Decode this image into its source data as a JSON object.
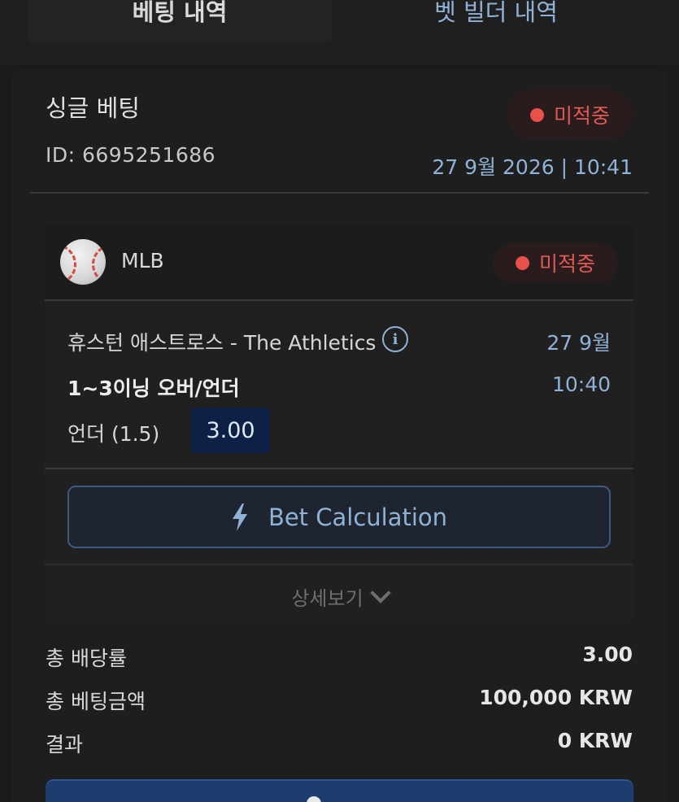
{
  "tabs": {
    "betting_history": "베팅 내역",
    "bet_builder_history": "벳 빌더 내역"
  },
  "bet": {
    "type": "싱글 베팅",
    "id": "ID: 6695251686",
    "status": "미적중",
    "datetime": "27 9월 2026 | 10:41"
  },
  "selection": {
    "league": "MLB",
    "status": "미적중",
    "match": "휴스턴 애스트로스 - The Athletics",
    "match_date": "27 9월",
    "market": "1~3이닝 오버/언더",
    "match_time": "10:40",
    "pick": "언더 (1.5)",
    "odds": "3.00"
  },
  "actions": {
    "bet_calculation": "Bet Calculation",
    "details": "상세보기"
  },
  "summary": {
    "total_odds_label": "총 배당률",
    "total_odds_value": "3.00",
    "total_stake_label": "총 베팅금액",
    "total_stake_value": "100,000 KRW",
    "result_label": "결과",
    "result_value": "0 KRW"
  },
  "colors": {
    "accent_blue": "#8fb2d6",
    "lost_red": "#e05a55",
    "odds_box": "#0f2046",
    "primary_button": "#1d3d6e"
  }
}
